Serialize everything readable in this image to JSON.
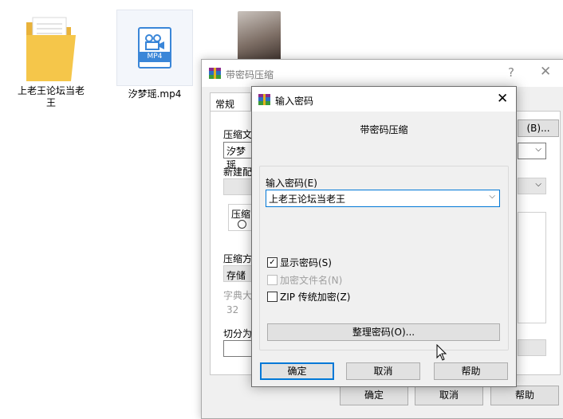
{
  "desktop": {
    "icons": [
      {
        "label": "上老王论坛当老\n王",
        "type": "folder"
      },
      {
        "label": "汐梦瑶.mp4",
        "type": "video",
        "badge": "MP4"
      },
      {
        "label": "",
        "type": "image"
      }
    ]
  },
  "back_window": {
    "title": "带密码压缩",
    "help_glyph": "?",
    "close_glyph": "✕",
    "tab_general": "常规",
    "labels": {
      "archive_name": "压缩文",
      "archive_value": "汐梦瑶",
      "new_profile": "新建配",
      "archive_format": "压缩",
      "method": "压缩方",
      "method_value": "存储",
      "dict": "字典大",
      "dict_value": "32",
      "split": "切分为"
    },
    "browse_button": "(B)...",
    "ok_button": "确定",
    "cancel_button": "取消",
    "help_button": "帮助"
  },
  "password_dialog": {
    "title": "输入密码",
    "close_glyph": "✕",
    "heading": "带密码压缩",
    "password_label": "输入密码(E)",
    "password_value": "上老王论坛当老王",
    "show_password": {
      "label": "显示密码(S)",
      "checked": true
    },
    "encrypt_names": {
      "label": "加密文件名(N)",
      "checked": false,
      "disabled": true
    },
    "zip_legacy": {
      "label": "ZIP 传统加密(Z)",
      "checked": false
    },
    "organize_button": "整理密码(O)...",
    "ok_button": "确定",
    "cancel_button": "取消",
    "help_button": "帮助"
  },
  "colors": {
    "accent": "#0078d7",
    "folder": "#f5c64a",
    "mp4_icon": "#3a86d8"
  }
}
